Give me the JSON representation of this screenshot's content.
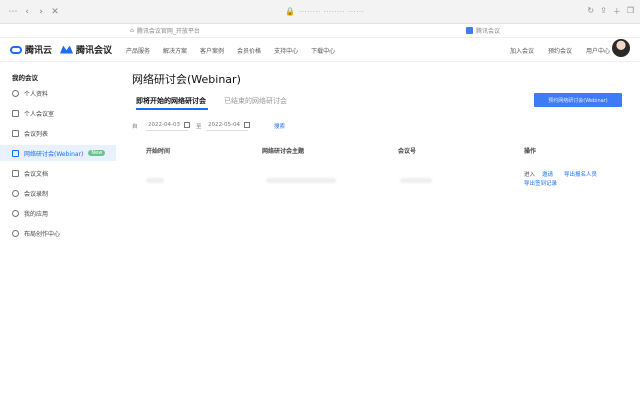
{
  "browser": {
    "address": "········ ········ ······",
    "bookmark_left": "腾讯会议官网_开放平台",
    "bookmark_right": "腾讯会议"
  },
  "header": {
    "brand_cloud": "腾讯云",
    "brand_meeting": "腾讯会议",
    "nav": [
      "产品服务",
      "解决方案",
      "客户案例",
      "会员价格",
      "支持中心",
      "下载中心"
    ],
    "join_meeting": "加入会议",
    "schedule_meeting": "预约会议",
    "user_center": "用户中心"
  },
  "sidebar": {
    "title": "我的会议",
    "items": [
      {
        "label": "个人资料"
      },
      {
        "label": "个人会议室"
      },
      {
        "label": "会议列表"
      },
      {
        "label": "网络研讨会(Webinar)",
        "badge": "New"
      },
      {
        "label": "会议文档"
      },
      {
        "label": "会议录制"
      },
      {
        "label": "我的应用"
      },
      {
        "label": "布局创作中心"
      }
    ]
  },
  "main": {
    "title": "网络研讨会(Webinar)",
    "tab_upcoming": "即将开始的网络研讨会",
    "tab_ended": "已结束的网络研讨会",
    "create_button": "预约网络研讨会(Webinar)",
    "filter": {
      "from_label": "自",
      "start_date": "2022-04-03",
      "to_label": "至",
      "end_date": "2022-05-04",
      "search_label": "搜索"
    },
    "columns": [
      "开始时间",
      "网络研讨会主题",
      "会议号",
      "操作"
    ],
    "row_actions": {
      "enter": "进入",
      "invite": "邀请",
      "export_registrants": "导出报名人员",
      "export_checkin": "导出签到记录"
    }
  },
  "colors": {
    "accent": "#1b6ef3",
    "active_bg": "#eaf1fe",
    "button": "#3d7bf7"
  }
}
